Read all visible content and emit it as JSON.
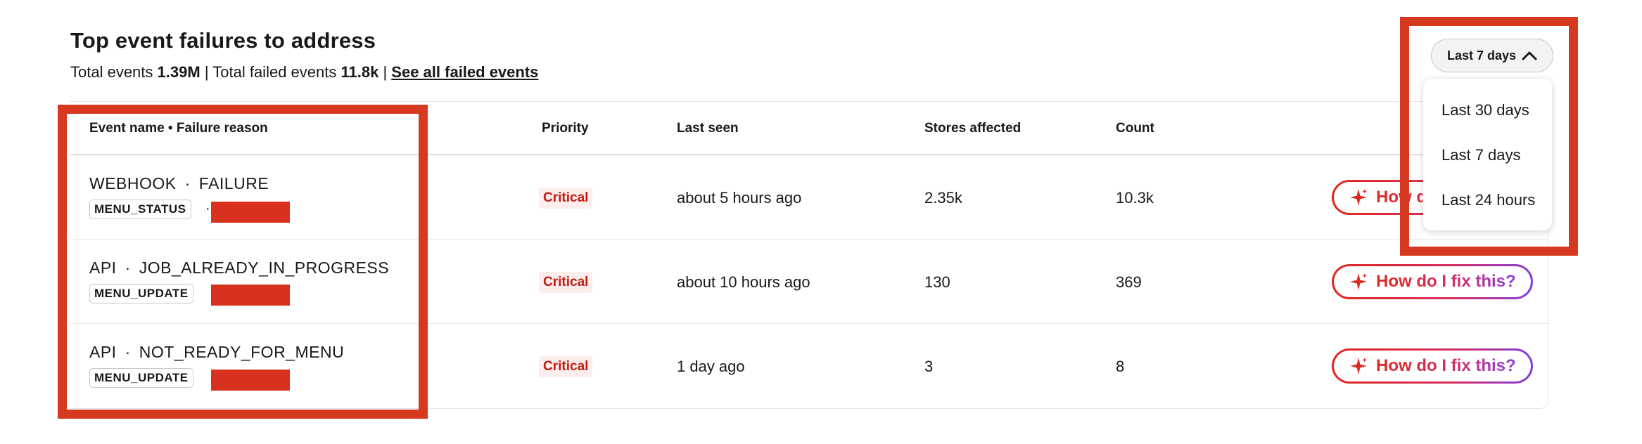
{
  "header": {
    "title": "Top event failures to address",
    "total_events_label": "Total events",
    "total_events_value": "1.39M",
    "separator": "|",
    "total_failed_label": "Total failed events",
    "total_failed_value": "11.8k",
    "see_all_link": "See all failed events"
  },
  "columns": {
    "event": "Event name • Failure reason",
    "priority": "Priority",
    "last_seen": "Last seen",
    "stores": "Stores affected",
    "count": "Count"
  },
  "rows": [
    {
      "event": "WEBHOOK",
      "reason": "FAILURE",
      "tag": "MENU_STATUS",
      "sep": "·",
      "priority": "Critical",
      "last_seen": "about 5 hours ago",
      "stores": "2.35k",
      "count": "10.3k",
      "action": "How do I fix this?"
    },
    {
      "event": "API",
      "reason": "JOB_ALREADY_IN_PROGRESS",
      "tag": "MENU_UPDATE",
      "sep": "·",
      "priority": "Critical",
      "last_seen": "about 10 hours ago",
      "stores": "130",
      "count": "369",
      "action": "How do I fix this?"
    },
    {
      "event": "API",
      "reason": "NOT_READY_FOR_MENU",
      "tag": "MENU_UPDATE",
      "sep": "·",
      "priority": "Critical",
      "last_seen": "1 day ago",
      "stores": "3",
      "count": "8",
      "action": "How do I fix this?"
    }
  ],
  "range_dropdown": {
    "selected": "Last 7 days",
    "options": [
      "Last 30 days",
      "Last 7 days",
      "Last 24 hours"
    ]
  },
  "colors": {
    "critical": "#c21a10",
    "highlight": "#d6391f",
    "action_gradient": [
      "#e0281c",
      "#7f3fe0"
    ]
  },
  "icons": [
    "sparkle-icon",
    "chevron-up-icon"
  ]
}
